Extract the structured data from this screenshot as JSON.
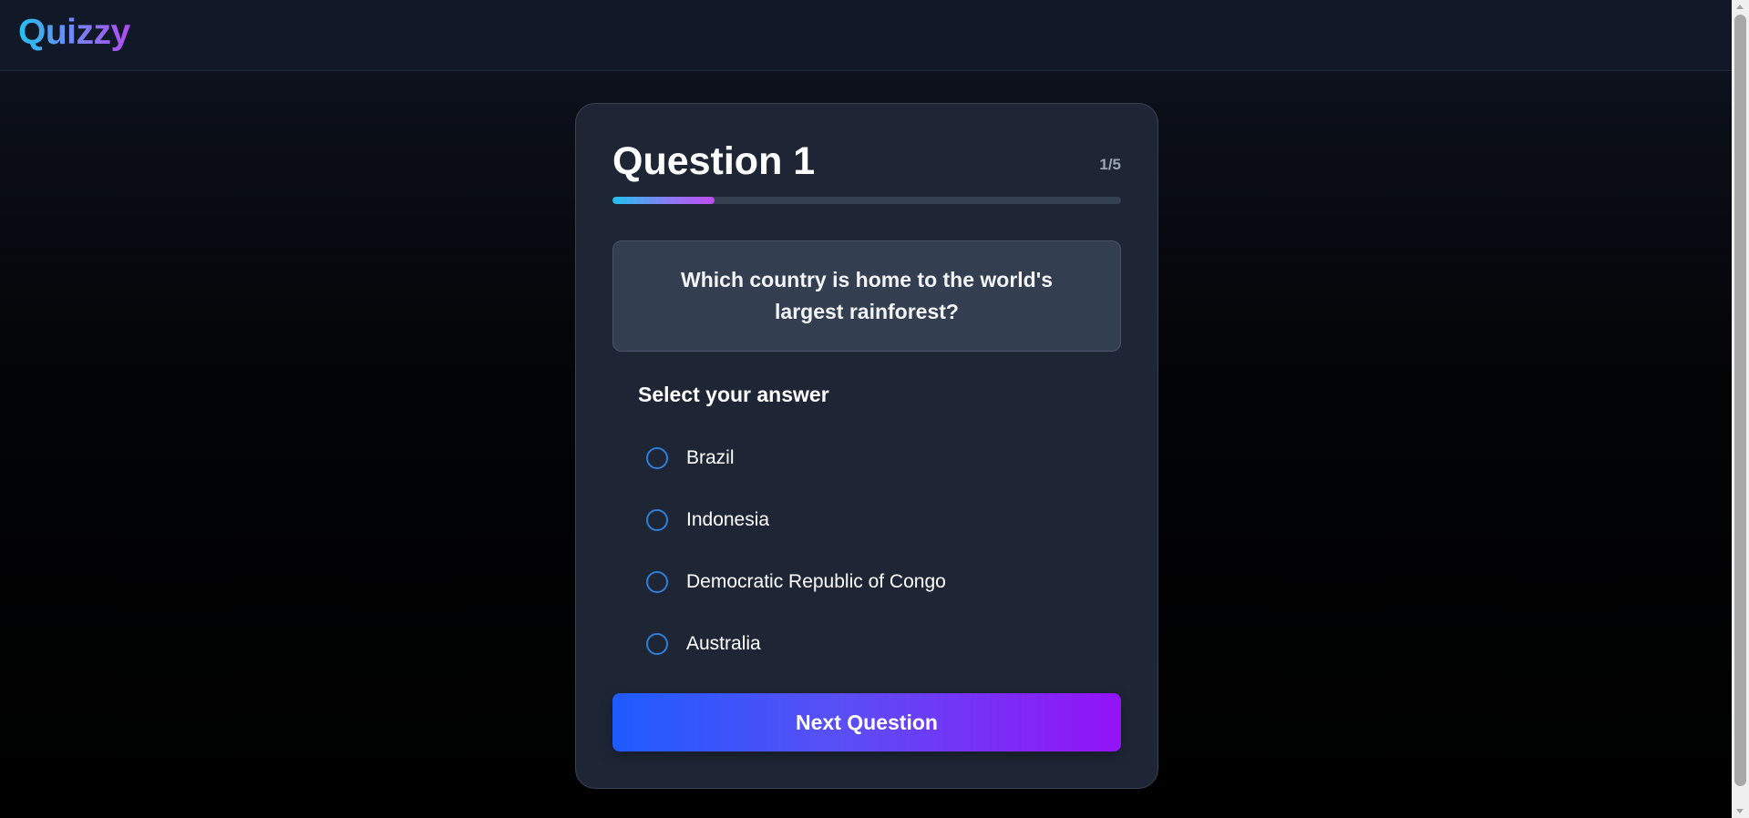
{
  "app": {
    "name": "Quizzy"
  },
  "quiz": {
    "question_title": "Question 1",
    "counter": "1/5",
    "progress_fraction": 0.2,
    "question_text": "Which country is home to the world's largest rainforest?",
    "answer_heading": "Select your answer",
    "options": [
      {
        "label": "Brazil",
        "selected": false
      },
      {
        "label": "Indonesia",
        "selected": false
      },
      {
        "label": "Democratic Republic of Congo",
        "selected": false
      },
      {
        "label": "Australia",
        "selected": false
      }
    ],
    "next_label": "Next Question"
  },
  "colors": {
    "page_background": "#000000",
    "card_background": "#1e2636",
    "radio_border": "#2e7fd8",
    "brand_gradient_start": "#22c1ee",
    "brand_gradient_end": "#b14af2",
    "button_gradient_start": "#1e5bff",
    "button_gradient_end": "#9413f7"
  }
}
